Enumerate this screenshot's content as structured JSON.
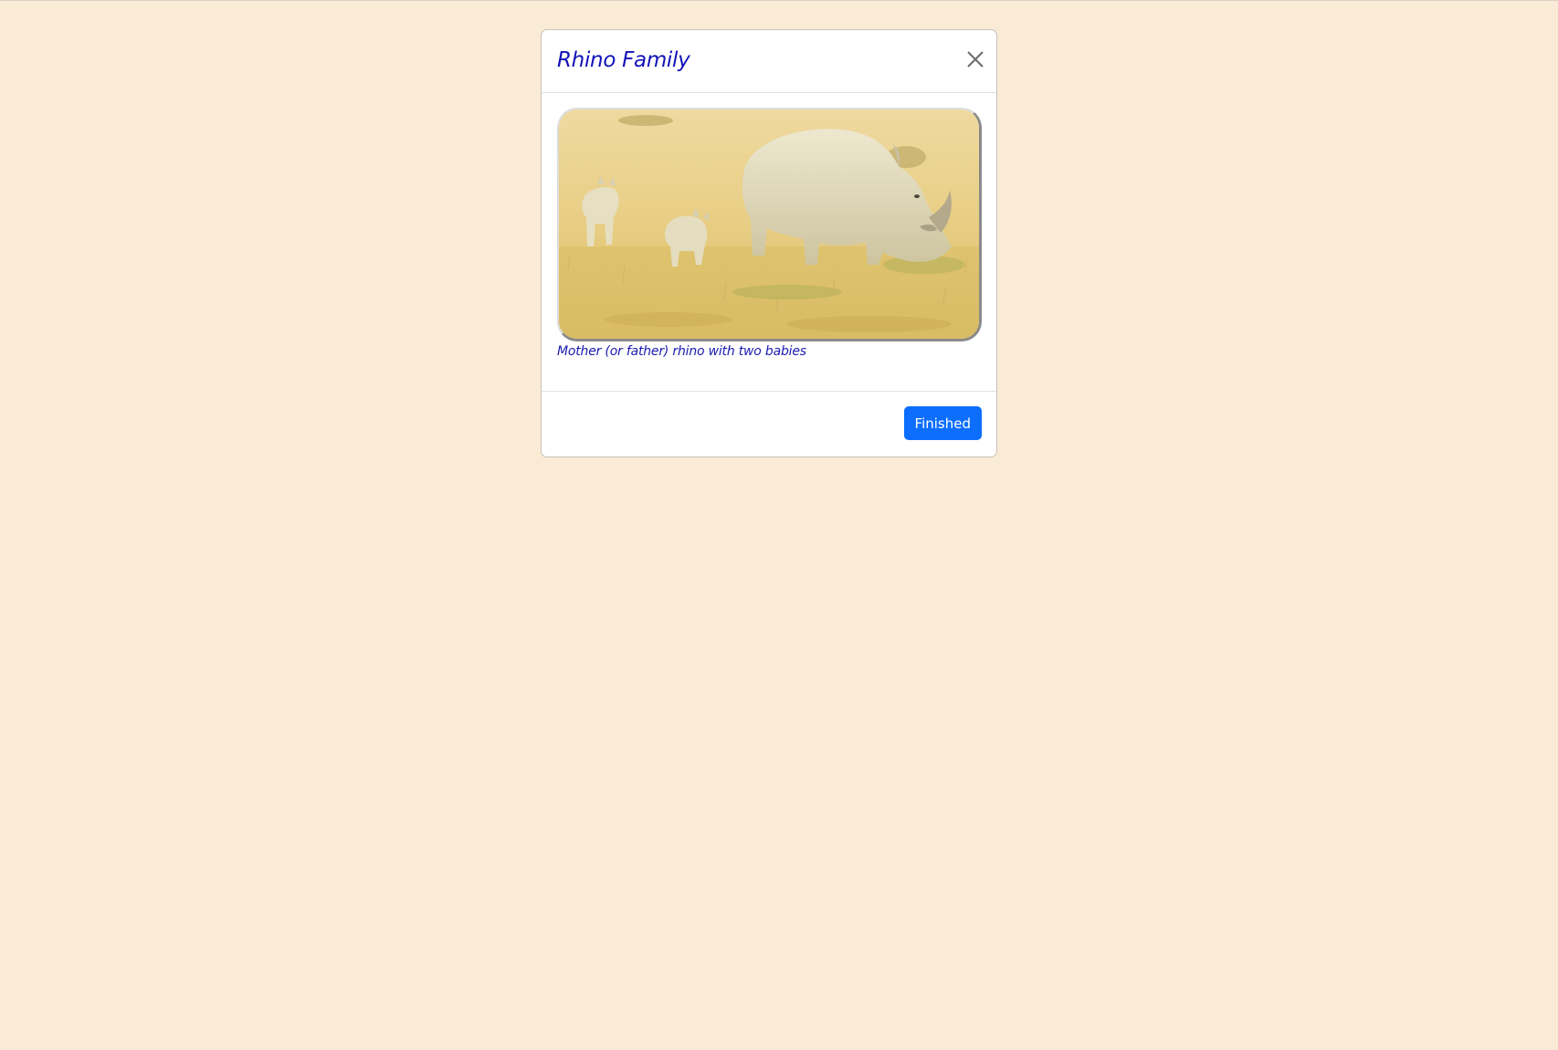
{
  "modal": {
    "title": "Rhino Family",
    "close_label": "Close",
    "image_alt": "Rhino family grazing",
    "caption": "Mother (or father) rhino with two babies",
    "finished_label": "Finished"
  },
  "colors": {
    "page_background": "#faebd7",
    "title_text": "#1212b8",
    "caption_text": "#1a1ab0",
    "button_primary": "#0d6efd"
  },
  "icons": {
    "close": "close-icon"
  }
}
